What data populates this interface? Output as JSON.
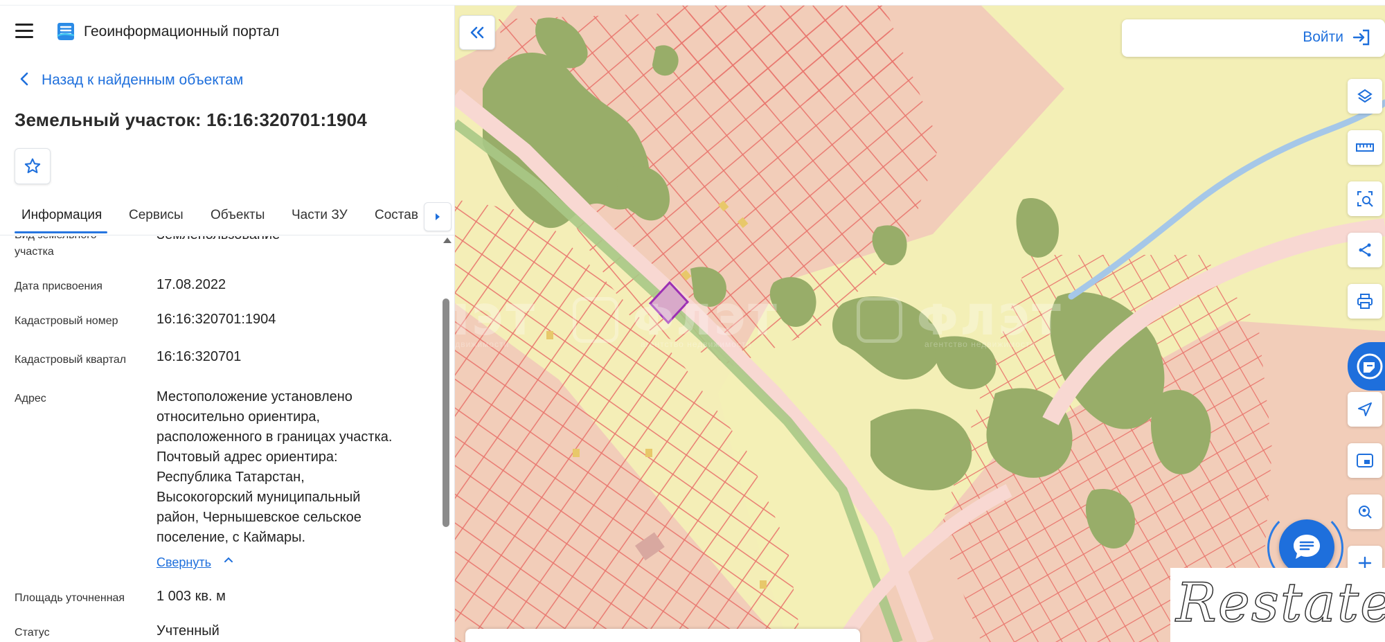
{
  "header": {
    "title": "Геоинформационный портал"
  },
  "nav": {
    "back_label": "Назад к найденным объектам"
  },
  "object": {
    "title": "Земельный участок: 16:16:320701:1904"
  },
  "tabs": [
    {
      "label": "Информация",
      "active": true
    },
    {
      "label": "Сервисы"
    },
    {
      "label": "Объекты"
    },
    {
      "label": "Части ЗУ"
    },
    {
      "label": "Состав"
    }
  ],
  "info": {
    "partial_label_top": "Вид земельного",
    "partial_label_bottom": "участка",
    "partial_value": "Землепользование",
    "date_label": "Дата присвоения",
    "date_value": "17.08.2022",
    "cadnum_label": "Кадастровый номер",
    "cadnum_value": "16:16:320701:1904",
    "quarter_label": "Кадастровый квартал",
    "quarter_value": "16:16:320701",
    "address_label": "Адрес",
    "address_lines": [
      "Местоположение установлено",
      "относительно ориентира,",
      "расположенного в границах участка.",
      "Почтовый адрес ориентира:",
      "Республика Татарстан,",
      "Высокогорский муниципальный",
      "район, Чернышевское сельское",
      "поселение, с Каймары."
    ],
    "collapse_label": "Свернуть",
    "area_label": "Площадь уточненная",
    "area_value": "1 003 кв. м",
    "status_label": "Статус",
    "status_value": "Учтенный"
  },
  "map": {
    "login_label": "Войти",
    "watermark_text": "ФЛЭТ",
    "watermark_sub": "агентство недвижимости"
  },
  "overlay": {
    "brand": "Restate"
  },
  "colors": {
    "accent": "#1e6fdc",
    "parcel_fill": "#f3cfbd",
    "parcel_line": "#e8746c",
    "forest": "#98ad69",
    "meadow": "#f3efb6",
    "selected_parcel": "#9c2fb4"
  },
  "icons": {
    "menu": "hamburger-icon",
    "logo": "portal-logo-icon",
    "back": "chevron-left-icon",
    "favorite": "star-icon",
    "collapse_panel": "double-chevron-left-icon",
    "login": "login-arrow-icon",
    "tools": [
      "layers-icon",
      "ruler-icon",
      "select-area-icon",
      "share-icon",
      "print-icon",
      "brand-icon",
      "navigate-icon",
      "minimap-icon",
      "location-search-icon",
      "zoom-in-icon"
    ],
    "chat": "chat-icon"
  }
}
